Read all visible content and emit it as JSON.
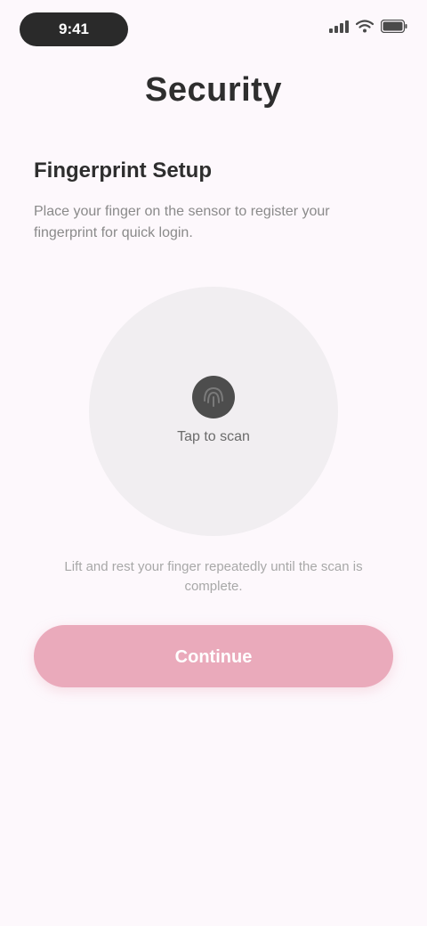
{
  "status_bar": {
    "time": "9:41",
    "icons": [
      "signal-icon",
      "wifi-icon",
      "battery-icon"
    ]
  },
  "header": {
    "title": "Security"
  },
  "section": {
    "heading": "Fingerprint Setup",
    "description": "Place your finger on the sensor to register your fingerprint for quick login."
  },
  "scan": {
    "icon": "fingerprint-icon",
    "label": "Tap to scan"
  },
  "hint": {
    "text": "Lift and rest your finger repeatedly until the scan is complete."
  },
  "actions": {
    "primary_label": "Continue"
  },
  "colors": {
    "background": "#fdf8fc",
    "accent": "#eaaabb",
    "scan_bg": "#f1eef1",
    "text_primary": "#2e2e2e",
    "text_secondary": "#8a8a8a"
  }
}
